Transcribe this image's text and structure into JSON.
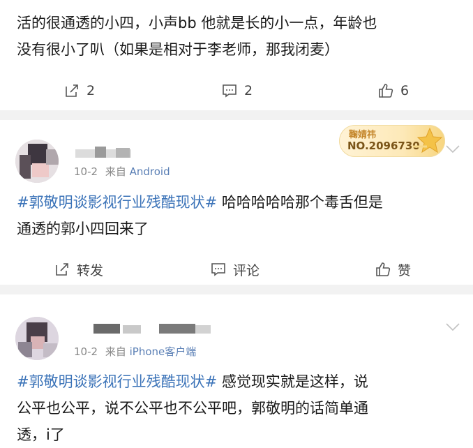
{
  "posts": [
    {
      "text_line1": "活的很通透的小四，小声bb 他就是长的小一点，年龄也",
      "text_line2": "没有很小了叭（如果是相对于李老师，那我闭麦）",
      "repost_label": "2",
      "comment_label": "2",
      "like_label": "6"
    },
    {
      "meta_date": "10-2",
      "meta_from": "来自",
      "meta_source": "Android",
      "badge_name": "鞠婧祎",
      "badge_no": "NO.2096730",
      "hashtag": "#郭敬明谈影视行业残酷现状#",
      "text_after_tag": " 哈哈哈哈哈那个毒舌但是",
      "text_line2": "通透的郭小四回来了",
      "repost_label": "转发",
      "comment_label": "评论",
      "like_label": "赞"
    },
    {
      "meta_date": "10-2",
      "meta_from": "来自",
      "meta_source": "iPhone客户端",
      "hashtag": "#郭敬明谈影视行业残酷现状#",
      "text_after_tag": " 感觉现实就是这样，说",
      "text_line2": "公平也公平，说不公平也不公平吧，郭敬明的话简单通",
      "text_line3": "透，i了"
    }
  ],
  "icons": {
    "repost": "repost-icon",
    "comment": "comment-icon",
    "like": "thumbs-up-icon",
    "more": "chevron-down-icon",
    "badge": "star-badge-icon"
  },
  "colors": {
    "hashtag": "#3b73b8",
    "source": "#5a7fb5",
    "separator": "#f2f2f2",
    "badge_text": "#7a5418"
  }
}
